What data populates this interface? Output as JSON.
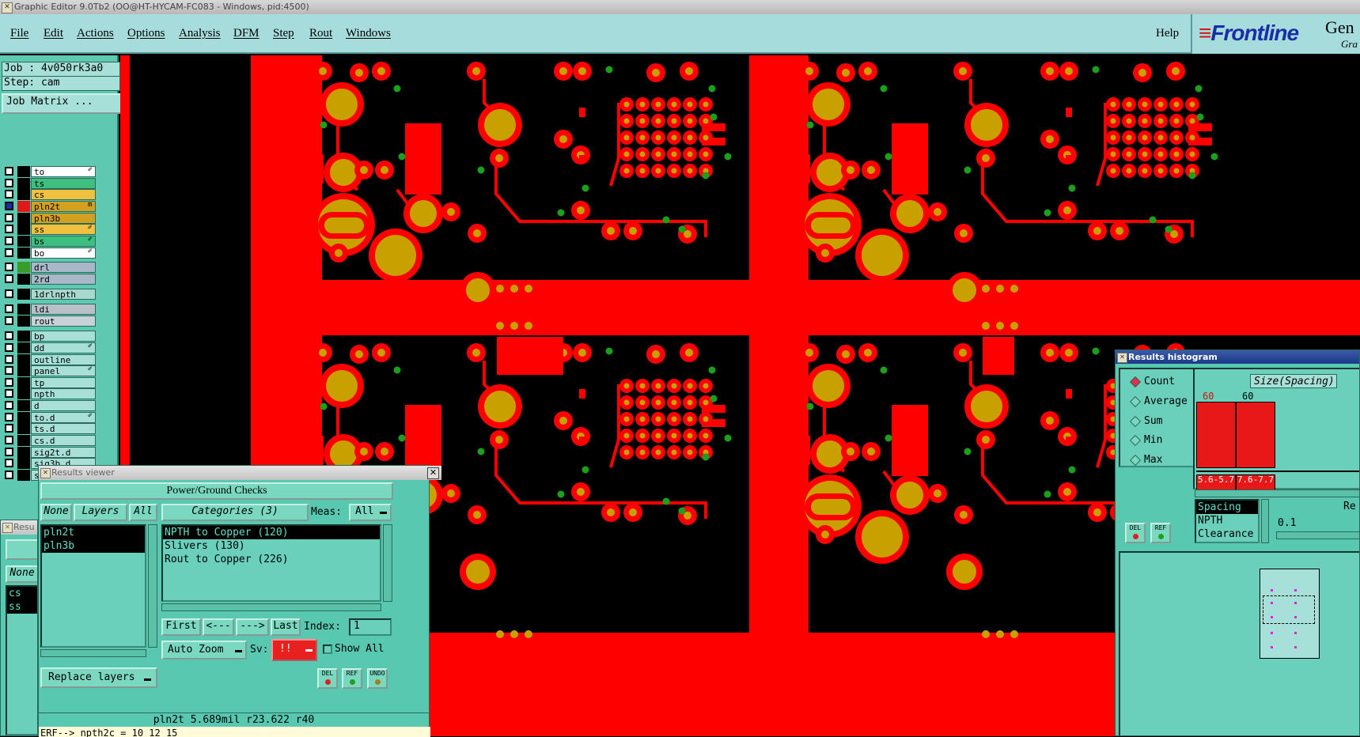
{
  "window": {
    "title": "Graphic Editor 9.0Tb2 (OO@HT-HYCAM-FC083 - Windows, pid:4500)"
  },
  "menu": {
    "items": [
      "File",
      "Edit",
      "Actions",
      "Options",
      "Analysis",
      "DFM",
      "Step",
      "Rout",
      "Windows"
    ],
    "help": "Help"
  },
  "logo": {
    "brand": "Frontline",
    "product": "Gen",
    "sub": "Gra"
  },
  "job": {
    "job_text": "Job : 4v050rk3a0",
    "step_text": "Step: cam",
    "matrix_label": "Job Matrix ..."
  },
  "layers": [
    {
      "name": "to",
      "color": "#ffffff",
      "swatch": "#000000",
      "checked": false,
      "mark": "✐"
    },
    {
      "name": "ts",
      "color": "#3fbf7f",
      "swatch": "#000000",
      "checked": false,
      "mark": ""
    },
    {
      "name": "cs",
      "color": "#f0c040",
      "swatch": "#000000",
      "checked": false,
      "mark": ""
    },
    {
      "name": "pln2t",
      "color": "#d4a020",
      "swatch": "#e01818",
      "checked": true,
      "mark": "m"
    },
    {
      "name": "pln3b",
      "color": "#d4a020",
      "swatch": "#000000",
      "checked": false,
      "mark": ""
    },
    {
      "name": "ss",
      "color": "#f0c040",
      "swatch": "#000000",
      "checked": false,
      "mark": "✐"
    },
    {
      "name": "bs",
      "color": "#3fbf7f",
      "swatch": "#000000",
      "checked": false,
      "mark": "✐"
    },
    {
      "name": "bo",
      "color": "#ffffff",
      "swatch": "#000000",
      "checked": false,
      "mark": "✐"
    },
    {
      "name": "drl",
      "color": "#a8b8c8",
      "swatch": "#3a9a2a",
      "checked": false,
      "mark": ""
    },
    {
      "name": "2rd",
      "color": "#a8b8c8",
      "swatch": "#000000",
      "checked": false,
      "mark": ""
    },
    {
      "name": "1drlnpth",
      "color": "#a8d8d0",
      "swatch": "#000000",
      "checked": false,
      "mark": ""
    },
    {
      "name": "ldi",
      "color": "#b8c0c8",
      "swatch": "#000000",
      "checked": false,
      "mark": ""
    },
    {
      "name": "rout",
      "color": "#c8d0d8",
      "swatch": "#000000",
      "checked": false,
      "mark": ""
    },
    {
      "name": "bp",
      "color": "#a8e0d8",
      "swatch": "#000000",
      "checked": false,
      "mark": ""
    },
    {
      "name": "dd",
      "color": "#a8e0d8",
      "swatch": "#000000",
      "checked": false,
      "mark": "✐"
    },
    {
      "name": "outline",
      "color": "#a8e0d8",
      "swatch": "#000000",
      "checked": false,
      "mark": ""
    },
    {
      "name": "panel",
      "color": "#a8e0d8",
      "swatch": "#000000",
      "checked": false,
      "mark": "✐"
    },
    {
      "name": "tp",
      "color": "#a8e0d8",
      "swatch": "#000000",
      "checked": false,
      "mark": ""
    },
    {
      "name": "npth",
      "color": "#a8e0d8",
      "swatch": "#000000",
      "checked": false,
      "mark": ""
    },
    {
      "name": "d",
      "color": "#a8e0d8",
      "swatch": "#000000",
      "checked": false,
      "mark": ""
    },
    {
      "name": "to.d",
      "color": "#a8e0d8",
      "swatch": "#000000",
      "checked": false,
      "mark": "✐"
    },
    {
      "name": "ts.d",
      "color": "#a8e0d8",
      "swatch": "#000000",
      "checked": false,
      "mark": ""
    },
    {
      "name": "cs.d",
      "color": "#a8e0d8",
      "swatch": "#000000",
      "checked": false,
      "mark": ""
    },
    {
      "name": "sig2t.d",
      "color": "#a8e0d8",
      "swatch": "#000000",
      "checked": false,
      "mark": ""
    },
    {
      "name": "sig3b.d",
      "color": "#a8e0d8",
      "swatch": "#000000",
      "checked": false,
      "mark": ""
    },
    {
      "name": "ss.d",
      "color": "#a8e0d8",
      "swatch": "#000000",
      "checked": false,
      "mark": "✐"
    }
  ],
  "results_viewer": {
    "title": "Results viewer",
    "heading": "Power/Ground Checks",
    "none_btn": "None",
    "layers_btn": "Layers",
    "all_btn": "All",
    "layer_list": [
      "pln2t",
      "pln3b"
    ],
    "categories_btn": "Categories (3)",
    "meas_label": "Meas:",
    "meas_value": "All",
    "categories": [
      "NPTH to Copper (120)",
      "Slivers (130)",
      "Rout to Copper (226)"
    ],
    "first_btn": "First",
    "prev_btn": "<---",
    "next_btn": "--->",
    "last_btn": "Last",
    "index_label": "Index:",
    "index_value": "1",
    "auto_zoom": "Auto Zoom",
    "sv_label": "Sv:",
    "sv_value": "!!",
    "show_all": "Show All",
    "replace_layers": "Replace layers",
    "del_label": "DEL",
    "ref_label": "REF",
    "undo_label": "UNDO",
    "status": "pln2t 5.689mil r23.622 r40",
    "command": "ERF--> npth2c = 10 12 15"
  },
  "results_viewer2": {
    "title": "Resu",
    "none_btn": "None",
    "layer_list": [
      "cs",
      "ss"
    ]
  },
  "histogram": {
    "title": "Results histogram",
    "modes": [
      "Count",
      "Average",
      "Sum",
      "Min",
      "Max"
    ],
    "selected_mode": "Count",
    "axis_label": "Size(Spacing)",
    "bins": [
      {
        "label": "5.6-5.7",
        "count": 60
      },
      {
        "label": "7.6-7.7",
        "count": 60
      }
    ],
    "categories": [
      "Spacing",
      "NPTH",
      "Clearance"
    ],
    "right_label": "Re",
    "right_value": "0.1",
    "del_label": "DEL",
    "ref_label": "REF"
  },
  "colors": {
    "copper": "#ff0000",
    "pad_gold": "#c8a000",
    "via_green": "#1aa01a",
    "panel_bg": "#58c8b0",
    "menu_bg": "#a6dcdc"
  }
}
